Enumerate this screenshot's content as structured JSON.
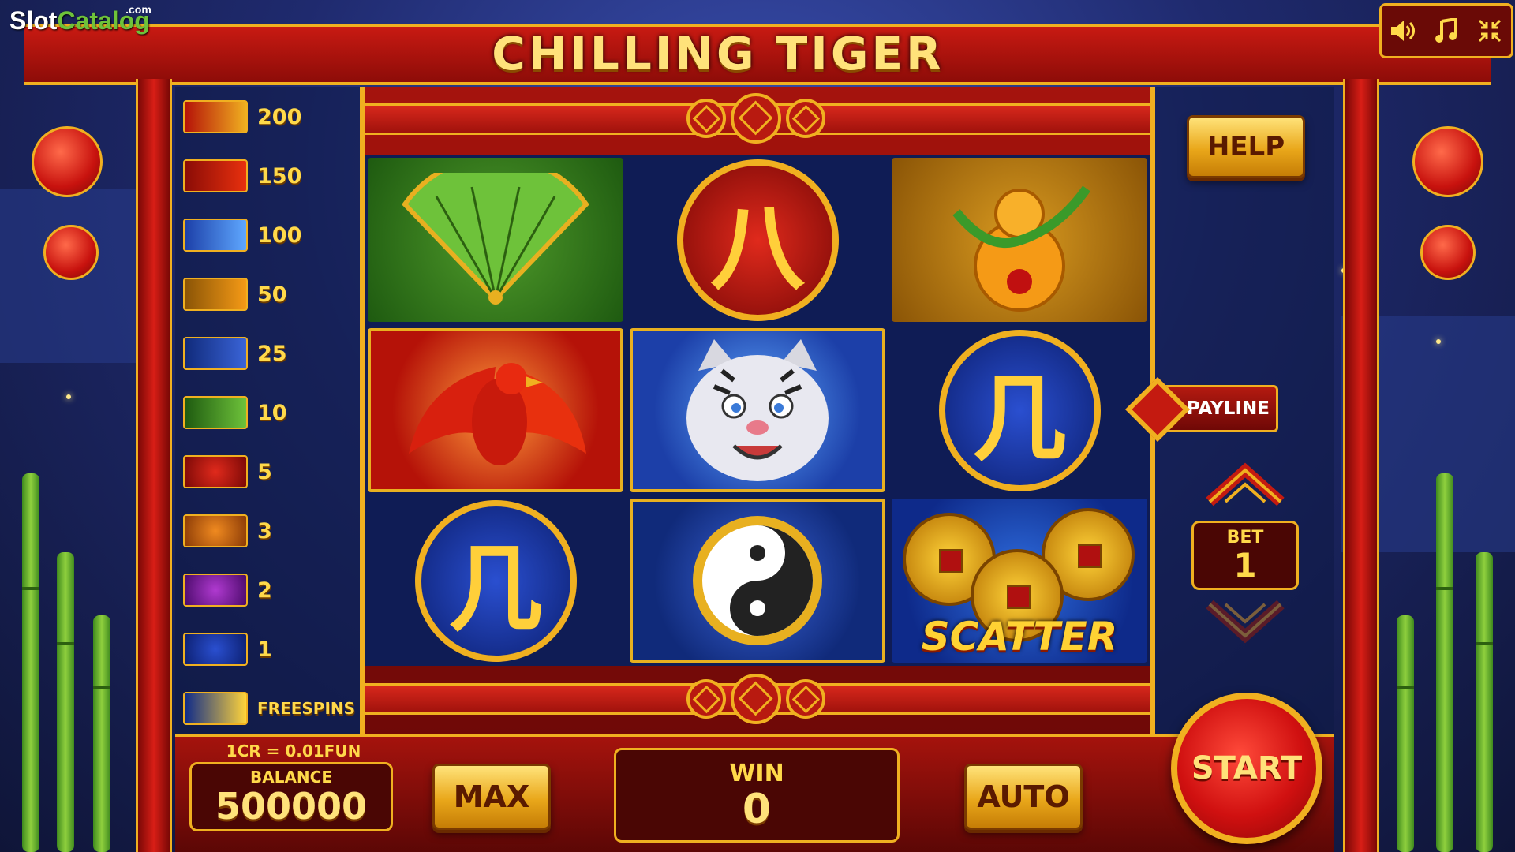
{
  "watermark": {
    "slot": "Slot",
    "catalog": "Catalog",
    "com": ".com"
  },
  "game": {
    "title": "CHILLING TIGER"
  },
  "controls": {
    "sound_icon": "speaker-icon",
    "music_icon": "music-note-icon",
    "fullscreen_icon": "exit-fullscreen-icon"
  },
  "paytable": {
    "rows": [
      {
        "symbol": "tiger",
        "value": "200"
      },
      {
        "symbol": "phoenix",
        "value": "150"
      },
      {
        "symbol": "tiger-medallion",
        "value": "100"
      },
      {
        "symbol": "gourd",
        "value": "50"
      },
      {
        "symbol": "yin-yang",
        "value": "25"
      },
      {
        "symbol": "fan",
        "value": "10"
      },
      {
        "symbol": "character-red",
        "value": "5"
      },
      {
        "symbol": "character-orange",
        "value": "3"
      },
      {
        "symbol": "character-purple",
        "value": "2"
      },
      {
        "symbol": "character-blue",
        "value": "1"
      },
      {
        "symbol": "scatter",
        "value": "FREESPINS"
      }
    ]
  },
  "reels": {
    "cells": [
      {
        "symbol": "fan"
      },
      {
        "symbol": "character-red",
        "glyph": "八"
      },
      {
        "symbol": "gourd"
      },
      {
        "symbol": "phoenix"
      },
      {
        "symbol": "tiger"
      },
      {
        "symbol": "character-blue",
        "glyph": "几"
      },
      {
        "symbol": "character-blue",
        "glyph": "几"
      },
      {
        "symbol": "yin-yang"
      },
      {
        "symbol": "scatter",
        "label": "SCATTER"
      }
    ]
  },
  "right_panel": {
    "help_label": "HELP",
    "payline_label": "PAYLINE",
    "bet_label": "BET",
    "bet_value": "1"
  },
  "bottom": {
    "rate": "1CR = 0.01FUN",
    "balance_label": "BALANCE",
    "balance_value": "500000",
    "max_label": "MAX",
    "win_label": "WIN",
    "win_value": "0",
    "auto_label": "AUTO",
    "start_label": "START"
  },
  "colors": {
    "gold": "#f0b020",
    "red": "#c81a12",
    "dark_red": "#4a0604",
    "navy": "#1f2a6e"
  }
}
